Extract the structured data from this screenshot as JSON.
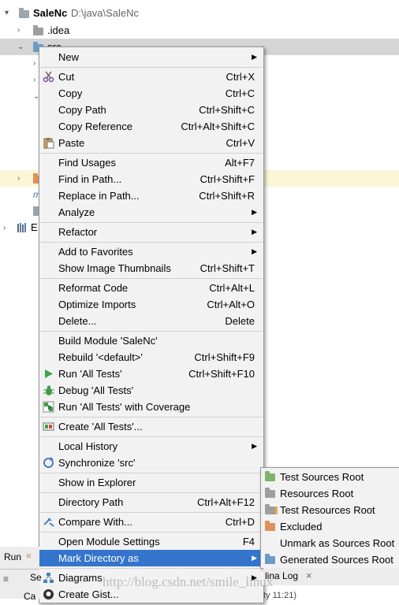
{
  "project": {
    "name": "SaleNc",
    "path": "D:\\java\\SaleNc",
    "rows": [
      ".idea",
      "src"
    ],
    "partial_row": "E"
  },
  "context_menu": {
    "items": [
      {
        "label": "New",
        "shortcut": "",
        "submenu": true,
        "icon": ""
      },
      {
        "label": "Cut",
        "shortcut": "Ctrl+X",
        "submenu": false,
        "icon": "scissors-icon"
      },
      {
        "label": "Copy",
        "shortcut": "Ctrl+C",
        "submenu": false,
        "icon": ""
      },
      {
        "label": "Copy Path",
        "shortcut": "Ctrl+Shift+C",
        "submenu": false,
        "icon": ""
      },
      {
        "label": "Copy Reference",
        "shortcut": "Ctrl+Alt+Shift+C",
        "submenu": false,
        "icon": ""
      },
      {
        "label": "Paste",
        "shortcut": "Ctrl+V",
        "submenu": false,
        "icon": "clipboard-icon"
      },
      {
        "label": "Find Usages",
        "shortcut": "Alt+F7",
        "submenu": false,
        "icon": ""
      },
      {
        "label": "Find in Path...",
        "shortcut": "Ctrl+Shift+F",
        "submenu": false,
        "icon": ""
      },
      {
        "label": "Replace in Path...",
        "shortcut": "Ctrl+Shift+R",
        "submenu": false,
        "icon": ""
      },
      {
        "label": "Analyze",
        "shortcut": "",
        "submenu": true,
        "icon": ""
      },
      {
        "label": "Refactor",
        "shortcut": "",
        "submenu": true,
        "icon": ""
      },
      {
        "label": "Add to Favorites",
        "shortcut": "",
        "submenu": true,
        "icon": ""
      },
      {
        "label": "Show Image Thumbnails",
        "shortcut": "Ctrl+Shift+T",
        "submenu": false,
        "icon": ""
      },
      {
        "label": "Reformat Code",
        "shortcut": "Ctrl+Alt+L",
        "submenu": false,
        "icon": ""
      },
      {
        "label": "Optimize Imports",
        "shortcut": "Ctrl+Alt+O",
        "submenu": false,
        "icon": ""
      },
      {
        "label": "Delete...",
        "shortcut": "Delete",
        "submenu": false,
        "icon": ""
      },
      {
        "label": "Build Module 'SaleNc'",
        "shortcut": "",
        "submenu": false,
        "icon": ""
      },
      {
        "label": "Rebuild '<default>'",
        "shortcut": "Ctrl+Shift+F9",
        "submenu": false,
        "icon": ""
      },
      {
        "label": "Run 'All Tests'",
        "shortcut": "Ctrl+Shift+F10",
        "submenu": false,
        "icon": "run-icon"
      },
      {
        "label": "Debug 'All Tests'",
        "shortcut": "",
        "submenu": false,
        "icon": "debug-icon"
      },
      {
        "label": "Run 'All Tests' with Coverage",
        "shortcut": "",
        "submenu": false,
        "icon": "coverage-icon"
      },
      {
        "label": "Create 'All Tests'...",
        "shortcut": "",
        "submenu": false,
        "icon": "create-config-icon"
      },
      {
        "label": "Local History",
        "shortcut": "",
        "submenu": true,
        "icon": ""
      },
      {
        "label": "Synchronize 'src'",
        "shortcut": "",
        "submenu": false,
        "icon": "sync-icon"
      },
      {
        "label": "Show in Explorer",
        "shortcut": "",
        "submenu": false,
        "icon": ""
      },
      {
        "label": "Directory Path",
        "shortcut": "Ctrl+Alt+F12",
        "submenu": false,
        "icon": ""
      },
      {
        "label": "Compare With...",
        "shortcut": "Ctrl+D",
        "submenu": false,
        "icon": "compare-icon"
      },
      {
        "label": "Open Module Settings",
        "shortcut": "F4",
        "submenu": false,
        "icon": ""
      },
      {
        "label": "Mark Directory as",
        "shortcut": "",
        "submenu": true,
        "icon": ""
      },
      {
        "label": "Diagrams",
        "shortcut": "",
        "submenu": true,
        "icon": "diagrams-icon"
      },
      {
        "label": "Create Gist...",
        "shortcut": "",
        "submenu": false,
        "icon": "github-icon"
      }
    ],
    "highlighted": "Mark Directory as"
  },
  "mark_directory_submenu": {
    "items": [
      {
        "label": "Test Sources Root",
        "icon": "test-sources-folder-icon"
      },
      {
        "label": "Resources Root",
        "icon": "resources-folder-icon"
      },
      {
        "label": "Test Resources Root",
        "icon": "test-resources-folder-icon"
      },
      {
        "label": "Excluded",
        "icon": "excluded-folder-icon"
      },
      {
        "label": "Unmark as Sources Root",
        "icon": ""
      },
      {
        "label": "Generated Sources Root",
        "icon": "generated-sources-folder-icon"
      }
    ]
  },
  "bottom": {
    "run_tab": "Run",
    "se_tab_partial": "Se",
    "log_tab": "lina Log",
    "close_glyph": "×",
    "status_partial": "Ca",
    "time_partial": "ty 11:21)",
    "collapse_glyph": "«"
  },
  "watermark": "http://blog.csdn.net/smile_linux"
}
